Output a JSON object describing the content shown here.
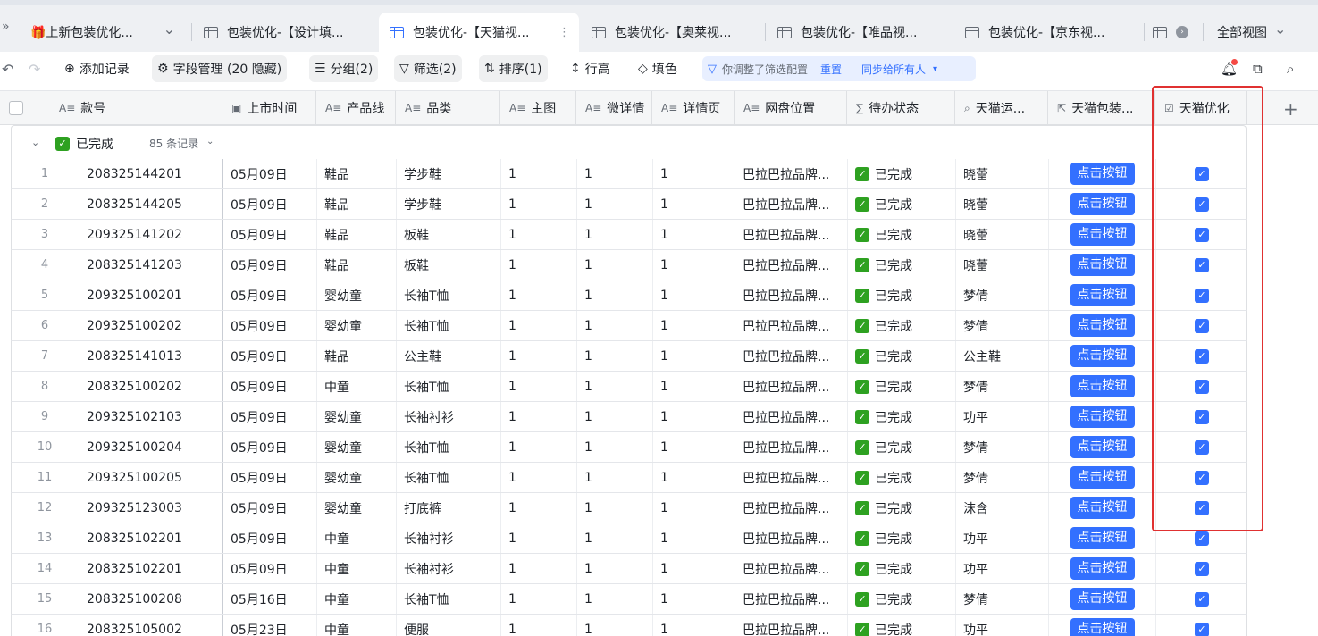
{
  "tabs": [
    {
      "label": "🎁上新包装优化...",
      "active": false
    },
    {
      "label": "包装优化-【设计填...",
      "active": false
    },
    {
      "label": "包装优化-【天猫视...",
      "active": true
    },
    {
      "label": "包装优化-【奥莱视...",
      "active": false
    },
    {
      "label": "包装优化-【唯品视...",
      "active": false
    },
    {
      "label": "包装优化-【京东视...",
      "active": false
    }
  ],
  "tab_overflow_left": "»",
  "tab_chevron": "⌄",
  "tab_menu_dots": "⋮",
  "all_views_label": "全部视图",
  "toolbar": {
    "undo": "↶",
    "redo": "↷",
    "add_record": "添加记录",
    "field_manage": "字段管理 (20 隐藏)",
    "group": "分组(2)",
    "filter": "筛选(2)",
    "sort": "排序(1)",
    "row_height": "行高",
    "fill": "填色",
    "filter_notice": "你调整了筛选配置",
    "reset": "重置",
    "sync_all": "同步给所有人"
  },
  "columns": [
    {
      "label": "款号",
      "icon": "A≡"
    },
    {
      "label": "上市时间",
      "icon": "▣"
    },
    {
      "label": "产品线",
      "icon": "A≡"
    },
    {
      "label": "品类",
      "icon": "A≡"
    },
    {
      "label": "主图",
      "icon": "A≡"
    },
    {
      "label": "微详情",
      "icon": "A≡"
    },
    {
      "label": "详情页",
      "icon": "A≡"
    },
    {
      "label": "网盘位置",
      "icon": "A≡"
    },
    {
      "label": "待办状态",
      "icon": "∑"
    },
    {
      "label": "天猫运...",
      "icon": "⌕"
    },
    {
      "label": "天猫包装...",
      "icon": "⇱"
    },
    {
      "label": "天猫优化",
      "icon": "☑"
    }
  ],
  "group": {
    "label": "已完成",
    "count": "85 条记录"
  },
  "button_label": "点击按钮",
  "rows": [
    {
      "idx": "1",
      "code": "208325144201",
      "date": "05月09日",
      "line": "鞋品",
      "cat": "学步鞋",
      "main": "1",
      "micro": "1",
      "detail": "1",
      "disk": "巴拉巴拉品牌...",
      "status": "已完成",
      "op": "晓蕾"
    },
    {
      "idx": "2",
      "code": "208325144205",
      "date": "05月09日",
      "line": "鞋品",
      "cat": "学步鞋",
      "main": "1",
      "micro": "1",
      "detail": "1",
      "disk": "巴拉巴拉品牌...",
      "status": "已完成",
      "op": "晓蕾"
    },
    {
      "idx": "3",
      "code": "209325141202",
      "date": "05月09日",
      "line": "鞋品",
      "cat": "板鞋",
      "main": "1",
      "micro": "1",
      "detail": "1",
      "disk": "巴拉巴拉品牌...",
      "status": "已完成",
      "op": "晓蕾"
    },
    {
      "idx": "4",
      "code": "208325141203",
      "date": "05月09日",
      "line": "鞋品",
      "cat": "板鞋",
      "main": "1",
      "micro": "1",
      "detail": "1",
      "disk": "巴拉巴拉品牌...",
      "status": "已完成",
      "op": "晓蕾"
    },
    {
      "idx": "5",
      "code": "209325100201",
      "date": "05月09日",
      "line": "婴幼童",
      "cat": "长袖T恤",
      "main": "1",
      "micro": "1",
      "detail": "1",
      "disk": "巴拉巴拉品牌...",
      "status": "已完成",
      "op": "梦倩"
    },
    {
      "idx": "6",
      "code": "209325100202",
      "date": "05月09日",
      "line": "婴幼童",
      "cat": "长袖T恤",
      "main": "1",
      "micro": "1",
      "detail": "1",
      "disk": "巴拉巴拉品牌...",
      "status": "已完成",
      "op": "梦倩"
    },
    {
      "idx": "7",
      "code": "208325141013",
      "date": "05月09日",
      "line": "鞋品",
      "cat": "公主鞋",
      "main": "1",
      "micro": "1",
      "detail": "1",
      "disk": "巴拉巴拉品牌...",
      "status": "已完成",
      "op": "公主鞋"
    },
    {
      "idx": "8",
      "code": "208325100202",
      "date": "05月09日",
      "line": "中童",
      "cat": "长袖T恤",
      "main": "1",
      "micro": "1",
      "detail": "1",
      "disk": "巴拉巴拉品牌...",
      "status": "已完成",
      "op": "梦倩"
    },
    {
      "idx": "9",
      "code": "209325102103",
      "date": "05月09日",
      "line": "婴幼童",
      "cat": "长袖衬衫",
      "main": "1",
      "micro": "1",
      "detail": "1",
      "disk": "巴拉巴拉品牌...",
      "status": "已完成",
      "op": "功平"
    },
    {
      "idx": "10",
      "code": "209325100204",
      "date": "05月09日",
      "line": "婴幼童",
      "cat": "长袖T恤",
      "main": "1",
      "micro": "1",
      "detail": "1",
      "disk": "巴拉巴拉品牌...",
      "status": "已完成",
      "op": "梦倩"
    },
    {
      "idx": "11",
      "code": "209325100205",
      "date": "05月09日",
      "line": "婴幼童",
      "cat": "长袖T恤",
      "main": "1",
      "micro": "1",
      "detail": "1",
      "disk": "巴拉巴拉品牌...",
      "status": "已完成",
      "op": "梦倩"
    },
    {
      "idx": "12",
      "code": "209325123003",
      "date": "05月09日",
      "line": "婴幼童",
      "cat": "打底裤",
      "main": "1",
      "micro": "1",
      "detail": "1",
      "disk": "巴拉巴拉品牌...",
      "status": "已完成",
      "op": "沫含"
    },
    {
      "idx": "13",
      "code": "208325102201",
      "date": "05月09日",
      "line": "中童",
      "cat": "长袖衬衫",
      "main": "1",
      "micro": "1",
      "detail": "1",
      "disk": "巴拉巴拉品牌...",
      "status": "已完成",
      "op": "功平"
    },
    {
      "idx": "14",
      "code": "208325102201",
      "date": "05月09日",
      "line": "中童",
      "cat": "长袖衬衫",
      "main": "1",
      "micro": "1",
      "detail": "1",
      "disk": "巴拉巴拉品牌...",
      "status": "已完成",
      "op": "功平"
    },
    {
      "idx": "15",
      "code": "208325100208",
      "date": "05月16日",
      "line": "中童",
      "cat": "长袖T恤",
      "main": "1",
      "micro": "1",
      "detail": "1",
      "disk": "巴拉巴拉品牌...",
      "status": "已完成",
      "op": "梦倩"
    },
    {
      "idx": "16",
      "code": "208325105002",
      "date": "05月23日",
      "line": "中童",
      "cat": "便服",
      "main": "1",
      "micro": "1",
      "detail": "1",
      "disk": "巴拉巴拉品牌...",
      "status": "已完成",
      "op": "功平"
    }
  ],
  "colors": {
    "accent": "#3370ff",
    "success": "#2ea121",
    "highlight": "#e03131"
  }
}
